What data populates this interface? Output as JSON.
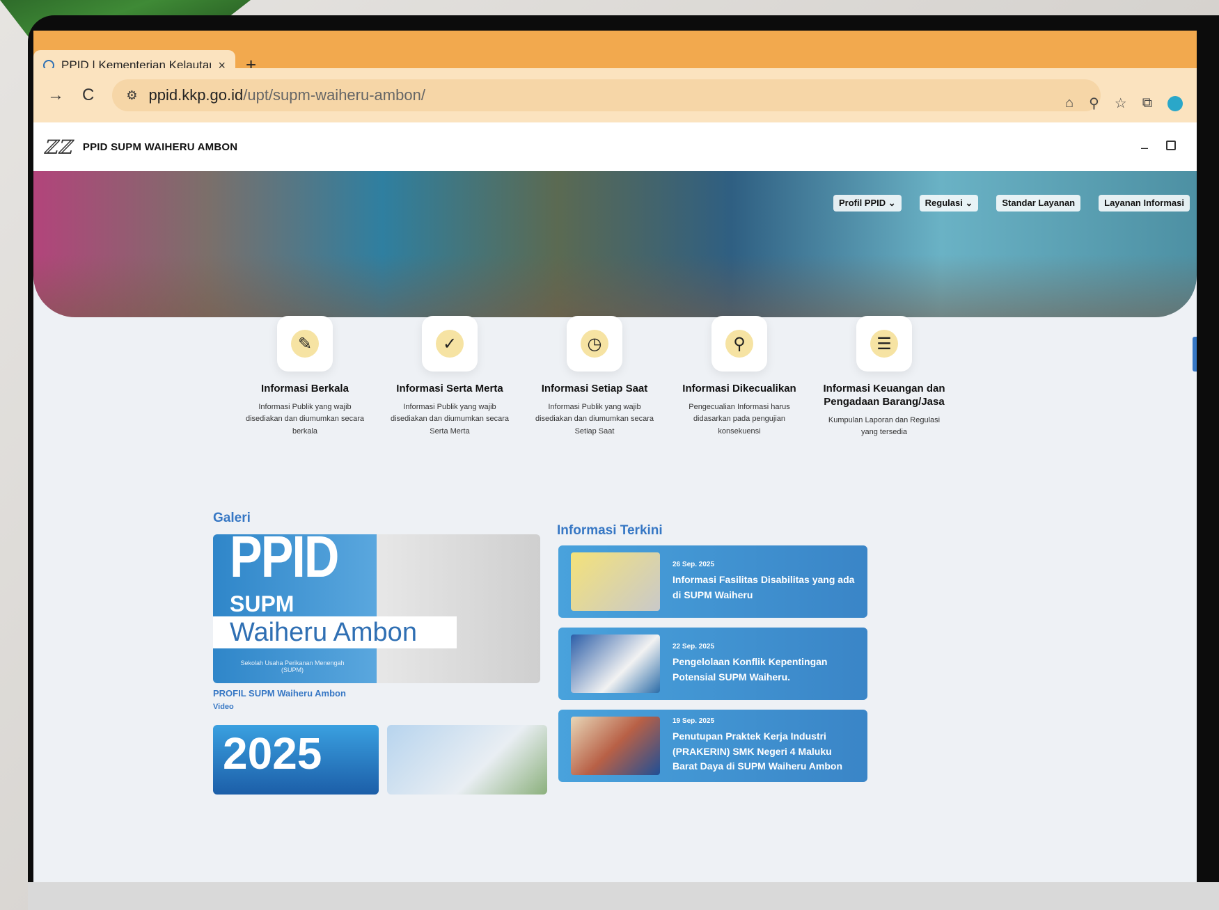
{
  "browser": {
    "tab_title": "PPID | Kementerian Kelautan d",
    "tab_close": "×",
    "new_tab": "+",
    "url_host": "ppid.kkp.go.id",
    "url_path": "/upt/supm-waiheru-ambon/",
    "back": "→",
    "reload": "C",
    "window_min": "–"
  },
  "site": {
    "logo": "ℤℤ",
    "name": "PPID SUPM WAIHERU AMBON"
  },
  "nav": {
    "items": [
      "Profil PPID ⌄",
      "Regulasi ⌄",
      "Standar Layanan",
      "Layanan Informasi"
    ]
  },
  "categories": [
    {
      "title": "Informasi Berkala",
      "desc": "Informasi Publik yang wajib disediakan dan diumumkan secara berkala"
    },
    {
      "title": "Informasi Serta Merta",
      "desc": "Informasi Publik yang wajib disediakan dan diumumkan secara Serta Merta"
    },
    {
      "title": "Informasi Setiap Saat",
      "desc": "Informasi Publik yang wajib disediakan dan diumumkan secara Setiap Saat"
    },
    {
      "title": "Informasi Dikecualikan",
      "desc": "Pengecualian Informasi harus didasarkan pada pengujian konsekuensi"
    },
    {
      "title": "Informasi Keuangan dan Pengadaan Barang/Jasa",
      "desc": "Kumpulan Laporan dan Regulasi yang tersedia"
    }
  ],
  "gallery": {
    "title": "Galeri",
    "banner_line1": "PPID",
    "banner_line2": "SUPM",
    "banner_line3": "Waiheru Ambon",
    "banner_sub": "Sekolah Usaha Perikanan Menengah (SUPM)",
    "caption": "PROFIL SUPM Waiheru Ambon",
    "type": "Video",
    "thumb1_text": "2025"
  },
  "news": {
    "title": "Informasi Terkini",
    "items": [
      {
        "date": "26 Sep. 2025",
        "headline": "Informasi Fasilitas Disabilitas yang ada di SUPM Waiheru"
      },
      {
        "date": "22 Sep. 2025",
        "headline": "Pengelolaan Konflik Kepentingan Potensial SUPM Waiheru."
      },
      {
        "date": "19 Sep. 2025",
        "headline": "Penutupan Praktek Kerja Industri (PRAKERIN) SMK Negeri 4 Maluku Barat Daya di SUPM Waiheru Ambon"
      }
    ]
  }
}
